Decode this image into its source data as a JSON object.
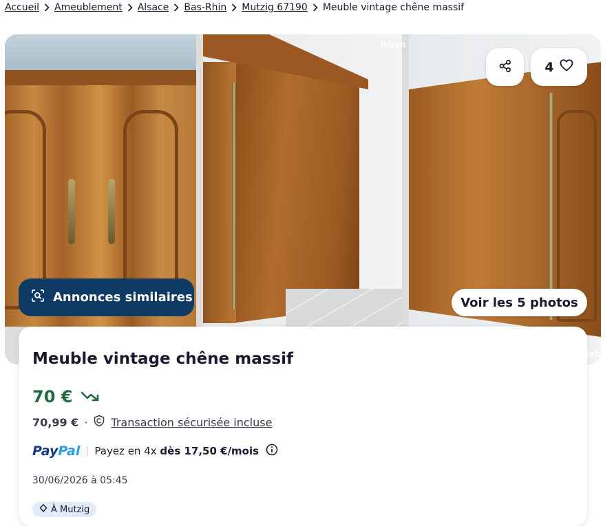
{
  "breadcrumb": {
    "items": [
      "Accueil",
      "Ameublement",
      "Alsace",
      "Bas-Rhin",
      "Mutzig 67190"
    ],
    "current": "Meuble vintage chêne massif"
  },
  "gallery": {
    "watermark": "lebon",
    "similar_label": "Annonces similaires",
    "view_photos_label": "Voir les 5 photos",
    "favorites_count": "4"
  },
  "ad": {
    "title": "Meuble vintage chêne massif",
    "price": "70 €",
    "price_with_fees": "70,99 €",
    "separator": "·",
    "secure_label": "Transaction sécurisée incluse",
    "paypal": {
      "logo_pay": "Pay",
      "logo_pal": "Pal",
      "text": "Payez en 4x",
      "amount": "dès 17,50 €/mois"
    },
    "date": "30/06/2026 à 05:45",
    "location": "À Mutzig"
  },
  "colors": {
    "price_green": "#1d6b3f",
    "similar_button": "#0e3a63",
    "paypal_dark": "#163b84",
    "paypal_light": "#2a9de5"
  }
}
